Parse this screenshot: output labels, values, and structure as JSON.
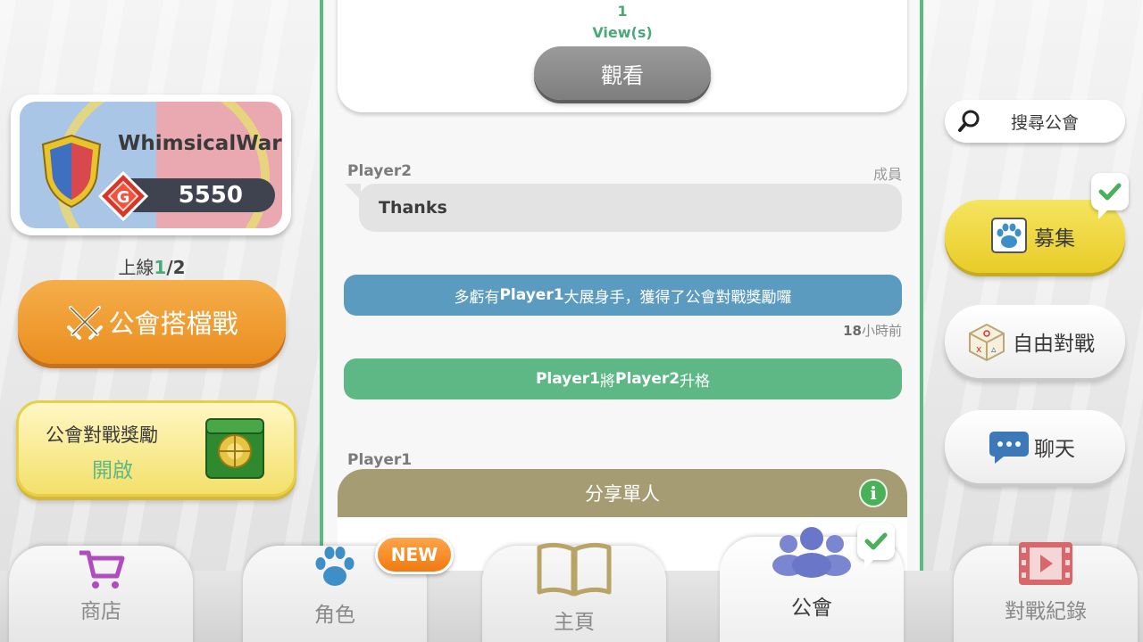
{
  "feed": {
    "top_post": {
      "views_count": "1",
      "views_label": "View(s)",
      "watch_button": "觀看"
    },
    "message": {
      "sender": "Player2",
      "role": "成員",
      "text": "Thanks"
    },
    "system_reward": {
      "text_prefix": "多虧有",
      "player": "Player1",
      "text_suffix": " 大展身手，獲得了公會對戰獎勵囉"
    },
    "time": {
      "number": "18",
      "unit": "小時前"
    },
    "system_promote": {
      "player_a": "Player1",
      "middle": "將",
      "player_b": "Player2",
      "suffix": "升格"
    },
    "next_sender": "Player1",
    "share_panel_title": "分享單人"
  },
  "profile": {
    "name": "WhimsicalWar",
    "score": "5550"
  },
  "online": {
    "label": "上線",
    "current": "1",
    "separator": "/",
    "total": "2"
  },
  "left_buttons": {
    "guild_partner_battle": "公會搭檔戰",
    "reward_title": "公會對戰獎勵",
    "reward_status": "開啟"
  },
  "right_buttons": {
    "search_guild": "搜尋公會",
    "recruit": "募集",
    "free_battle": "自由對戰",
    "chat": "聊天"
  },
  "nav": {
    "tabs": [
      {
        "label": "商店",
        "icon": "cart-icon"
      },
      {
        "label": "角色",
        "icon": "paw-icon"
      },
      {
        "label": "主頁",
        "icon": "book-icon"
      },
      {
        "label": "公會",
        "icon": "guild-members-icon"
      },
      {
        "label": "對戰紀錄",
        "icon": "film-icon"
      }
    ],
    "new_badge": "NEW",
    "active_tab": "公會"
  },
  "colors": {
    "accent_green": "#5db886",
    "system_blue": "#5b9bc0",
    "orange": "#ea8e1f",
    "yellow": "#e8cc28",
    "share_header": "#a69c74"
  }
}
